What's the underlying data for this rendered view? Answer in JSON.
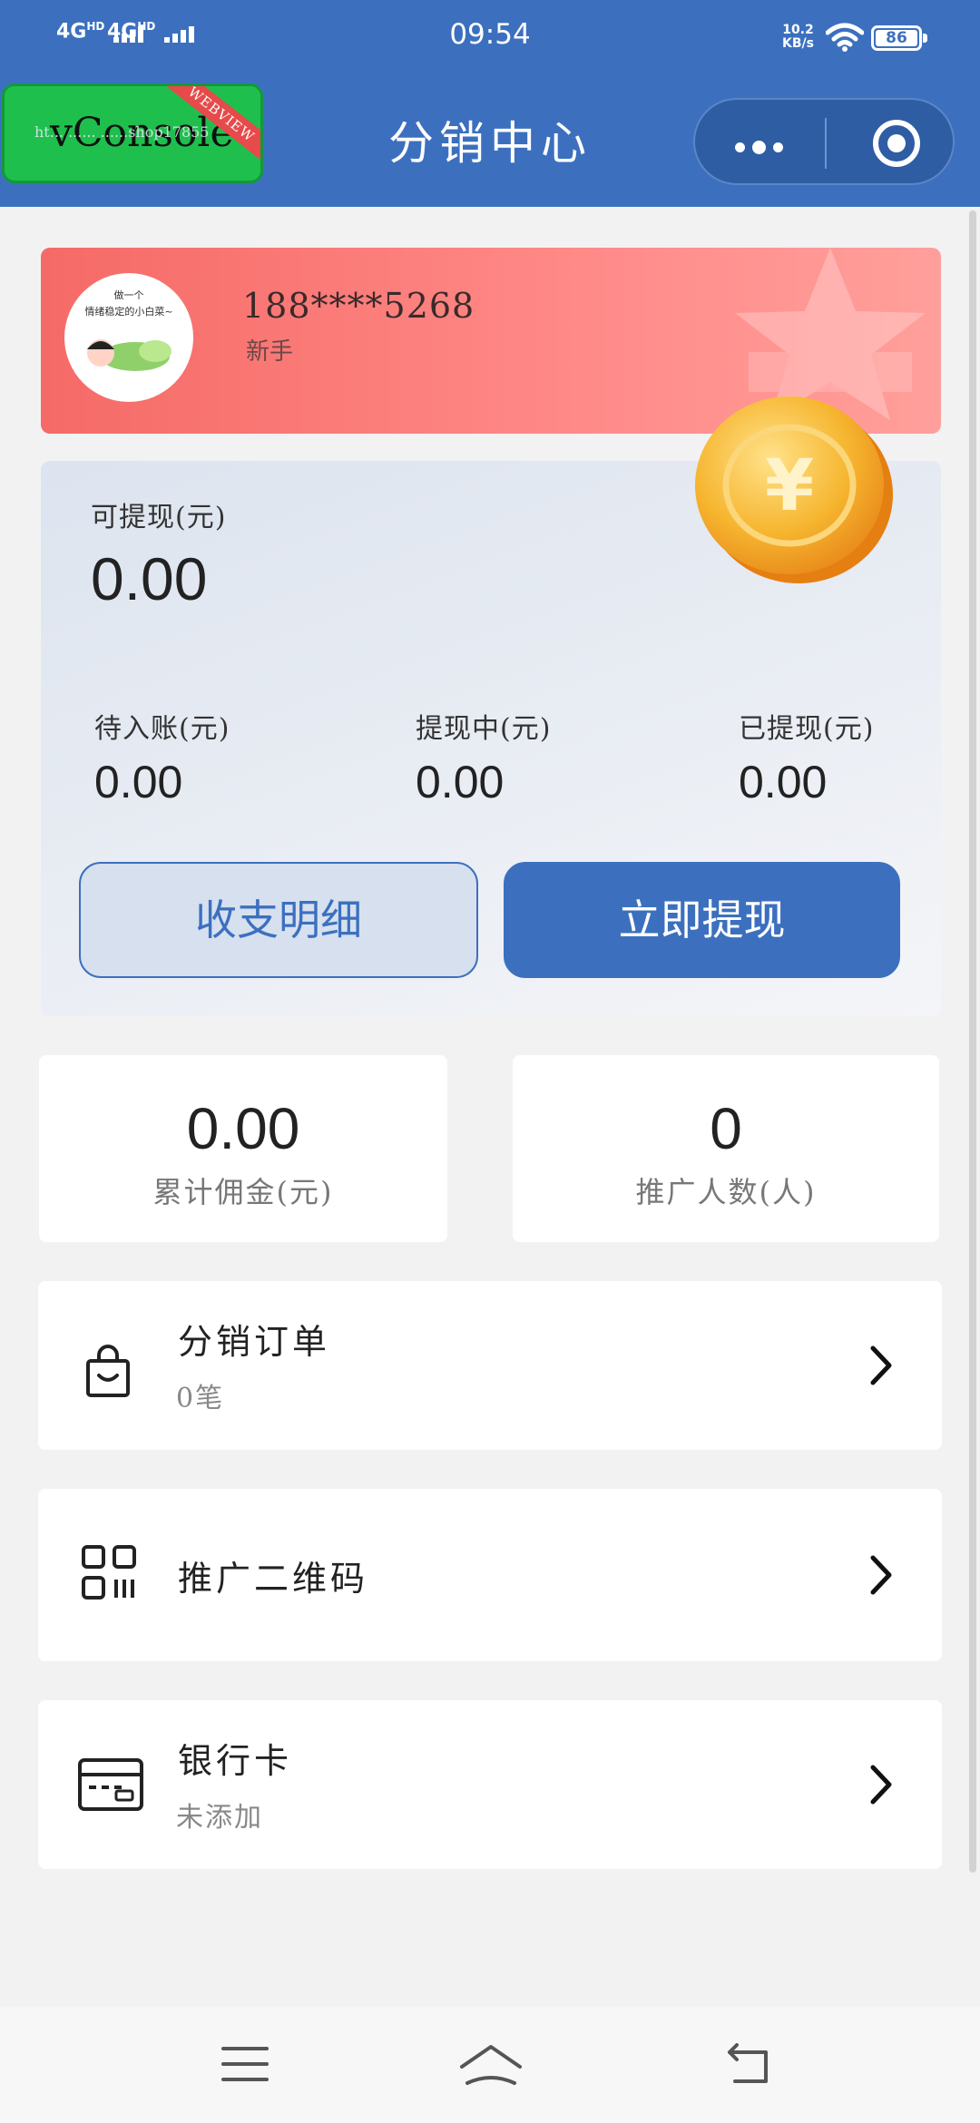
{
  "status_bar": {
    "signal_1": "4G",
    "signal_1_hd": "HD",
    "signal_2": "4G",
    "signal_2_hd": "HD",
    "time": "09:54",
    "net_speed_value": "10.2",
    "net_speed_unit": "KB/s",
    "battery": "86"
  },
  "header": {
    "title": "分销中心",
    "vconsole_label": "vConsole",
    "vconsole_ribbon": "WEBVIEW",
    "url_fragment": "ht... ...... ......shop17855"
  },
  "profile": {
    "phone": "188****5268",
    "level": "新手",
    "avatar_text_line1": "做一个",
    "avatar_text_line2": "情绪稳定的小白菜~"
  },
  "balance": {
    "withdrawable_label": "可提现(元)",
    "withdrawable_value": "0.00",
    "pending_label": "待入账(元)",
    "pending_value": "0.00",
    "withdrawing_label": "提现中(元)",
    "withdrawing_value": "0.00",
    "withdrawn_label": "已提现(元)",
    "withdrawn_value": "0.00",
    "detail_button": "收支明细",
    "withdraw_button": "立即提现"
  },
  "stats": {
    "commission_value": "0.00",
    "commission_label": "累计佣金(元)",
    "promoted_value": "0",
    "promoted_label": "推广人数(人)"
  },
  "menu": {
    "orders_title": "分销订单",
    "orders_sub": "0笔",
    "qrcode_title": "推广二维码",
    "bank_title": "银行卡",
    "bank_sub": "未添加"
  },
  "icons": {
    "orders": "shopping-bag-icon",
    "qrcode": "qr-code-icon",
    "bank": "bank-card-icon",
    "chevron": "chevron-right-icon"
  },
  "colors": {
    "primary": "#3c70bf",
    "profile_card": "#f56a66",
    "page_background": "#f2f2f3"
  }
}
